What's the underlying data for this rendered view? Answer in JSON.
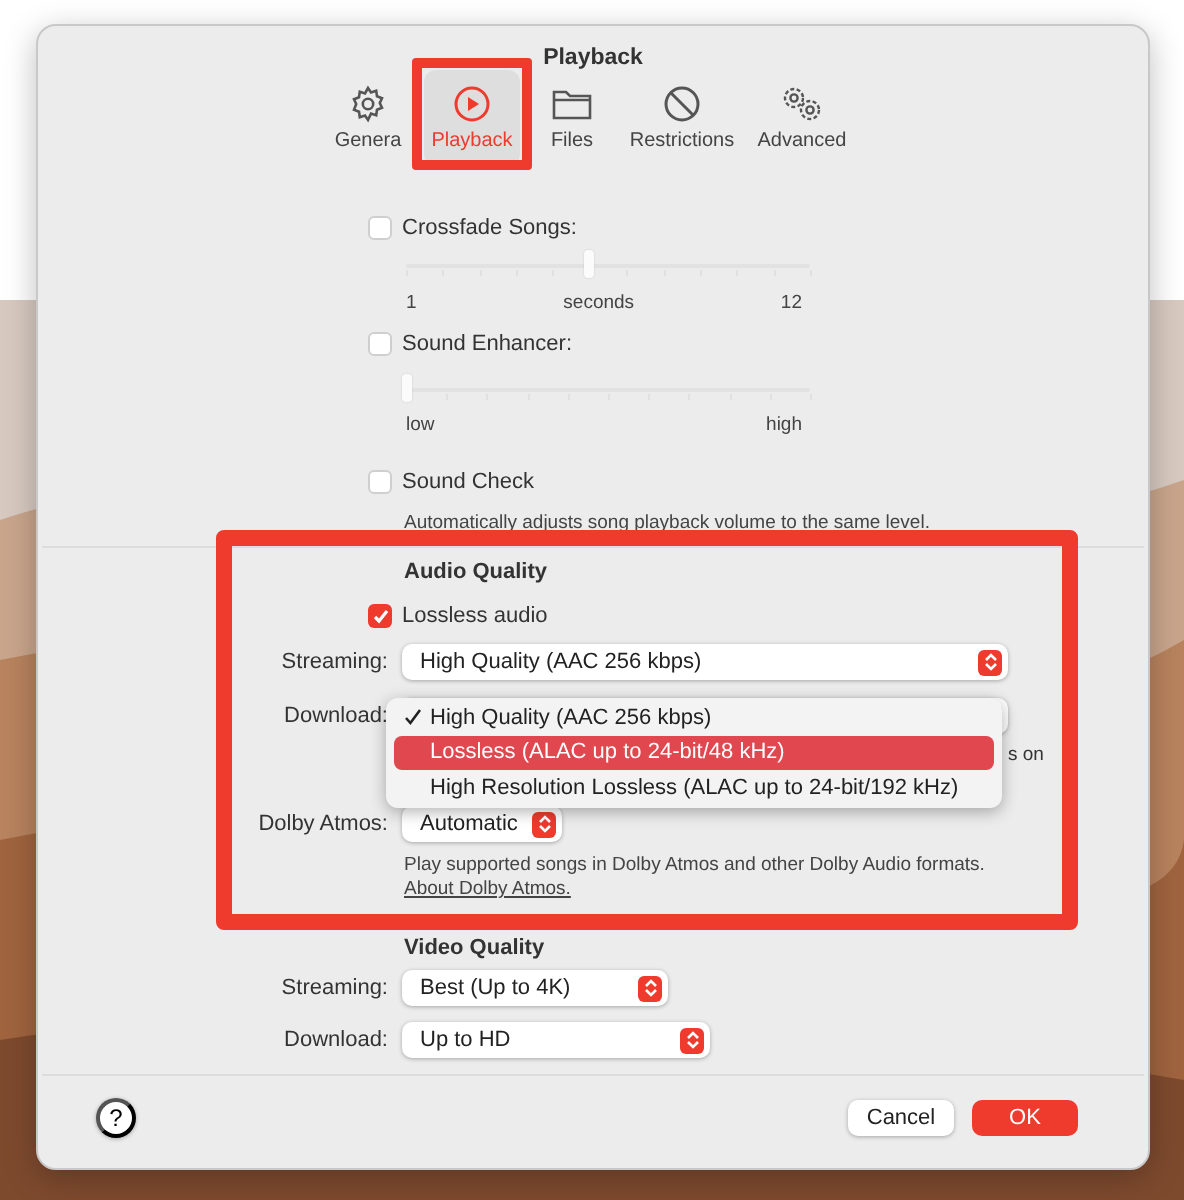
{
  "window": {
    "title": "Playback"
  },
  "tabs": [
    {
      "label": "Genera",
      "kind": "gear",
      "selected": false,
      "highlighted": false
    },
    {
      "label": "Playback",
      "kind": "play",
      "selected": true,
      "highlighted": true
    },
    {
      "label": "Files",
      "kind": "folder",
      "selected": false,
      "highlighted": false
    },
    {
      "label": "Restrictions",
      "kind": "prohibited",
      "selected": false,
      "highlighted": false
    },
    {
      "label": "Advanced",
      "kind": "gears",
      "selected": false,
      "highlighted": false
    }
  ],
  "crossfade": {
    "label": "Crossfade Songs:",
    "checked": false,
    "level": 0.45,
    "min_label": "1",
    "mid_label": "seconds",
    "max_label": "12"
  },
  "sound_enhancer": {
    "label": "Sound Enhancer:",
    "checked": false,
    "level": 0,
    "min_label": "low",
    "max_label": "high"
  },
  "sound_check": {
    "label": "Sound Check",
    "checked": false,
    "description": "Automatically adjusts song playback volume to the same level."
  },
  "audio_quality": {
    "heading": "Audio Quality",
    "highlighted": true,
    "lossless": {
      "label": "Lossless audio",
      "checked": true
    },
    "streaming": {
      "label": "Streaming:",
      "value": "High Quality (AAC 256 kbps)"
    },
    "download": {
      "label": "Download:",
      "menu": [
        {
          "label": "High Quality (AAC 256 kbps)",
          "checked": true,
          "selected": false
        },
        {
          "label": "Lossless (ALAC up to 24-bit/48 kHz)",
          "checked": false,
          "selected": true
        },
        {
          "label": "High Resolution Lossless (ALAC up to 24-bit/192 kHz)",
          "checked": false,
          "selected": false
        }
      ],
      "trailing_text": "s on"
    },
    "dolby_atmos": {
      "label": "Dolby Atmos:",
      "value": "Automatic"
    },
    "description": "Play supported songs in Dolby Atmos and other Dolby Audio formats.",
    "link": "About Dolby Atmos."
  },
  "video_quality": {
    "heading": "Video Quality",
    "streaming": {
      "label": "Streaming:",
      "value": "Best (Up to 4K)"
    },
    "download": {
      "label": "Download:",
      "value": "Up to HD"
    }
  },
  "footer": {
    "help": "?",
    "buttons": [
      {
        "label": "Cancel",
        "kind": "secondary"
      },
      {
        "label": "OK",
        "kind": "primary"
      }
    ]
  }
}
